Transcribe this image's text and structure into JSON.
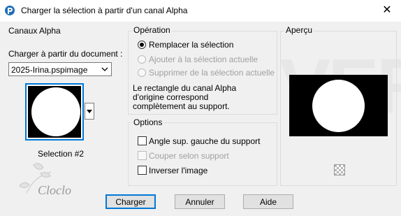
{
  "window": {
    "title": "Charger la sélection à partir d'un canal Alpha",
    "close_glyph": "✕"
  },
  "canaux": {
    "legend": "Canaux Alpha",
    "doc_label": "Charger à partir du document :",
    "doc_value": "2025-Irina.pspimage",
    "selection_name": "Selection #2"
  },
  "operation": {
    "legend": "Opération",
    "options": [
      {
        "label": "Remplacer la sélection",
        "checked": true,
        "enabled": true
      },
      {
        "label": "Ajouter à la sélection actuelle",
        "checked": false,
        "enabled": false
      },
      {
        "label": "Supprimer de la sélection actuelle",
        "checked": false,
        "enabled": false
      }
    ],
    "info": [
      "Le rectangle du canal Alpha",
      "d'origine correspond",
      "complètement au support."
    ]
  },
  "options": {
    "legend": "Options",
    "items": [
      {
        "label": "Angle sup. gauche du support",
        "checked": false,
        "enabled": true
      },
      {
        "label": "Couper selon support",
        "checked": false,
        "enabled": false
      },
      {
        "label": "Inverser l'image",
        "checked": false,
        "enabled": true
      }
    ]
  },
  "apercu": {
    "legend": "Aperçu"
  },
  "buttons": {
    "load": "Charger",
    "cancel": "Annuler",
    "help": "Aide"
  },
  "watermark_text": "Cloclo",
  "background_watermark": "VER"
}
